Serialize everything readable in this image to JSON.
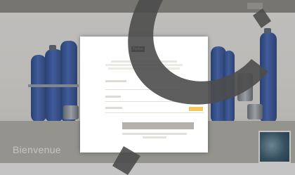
{
  "colors": {
    "topbar": "#8c8b83",
    "tank_blue": "#2f57b0",
    "banner": "#b8b7af",
    "forgot_button": "#f2c85c",
    "submit_button": "#b3b1aa",
    "watermark": "#555555"
  },
  "banner": {
    "welcome_text": "Bienvenue"
  },
  "modal": {
    "logo_text": "Parker",
    "icons": {
      "logo": "parker-logo-icon",
      "watermark": "swoosh-icon"
    }
  }
}
